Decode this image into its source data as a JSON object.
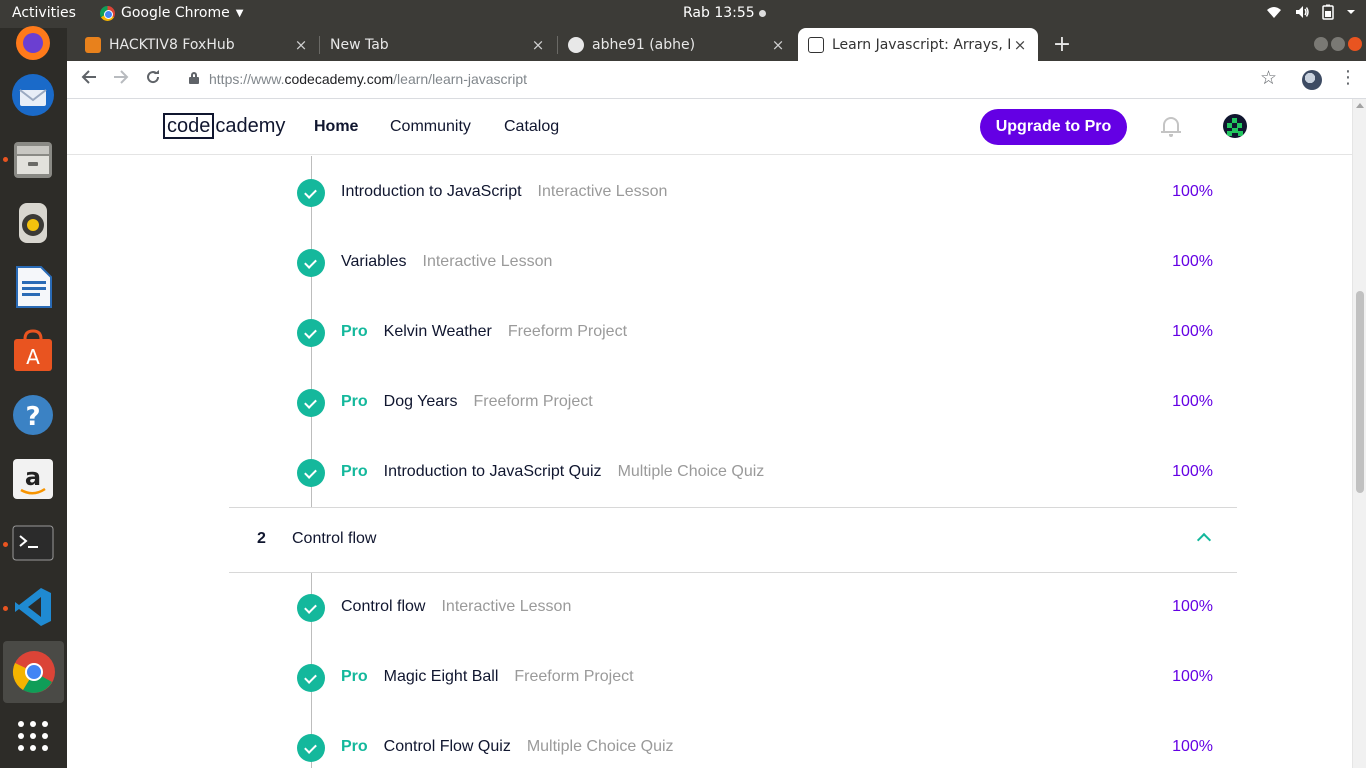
{
  "system": {
    "activities": "Activities",
    "app_name": "Google Chrome",
    "clock": "Rab 13:55"
  },
  "dock": [
    {
      "name": "firefox-icon"
    },
    {
      "name": "thunderbird-icon"
    },
    {
      "name": "files-icon"
    },
    {
      "name": "rhythmbox-icon"
    },
    {
      "name": "writer-icon"
    },
    {
      "name": "software-center-icon"
    },
    {
      "name": "help-icon"
    },
    {
      "name": "amazon-icon"
    },
    {
      "name": "terminal-icon"
    },
    {
      "name": "vscode-icon"
    },
    {
      "name": "chrome-icon"
    },
    {
      "name": "show-apps-icon"
    }
  ],
  "tabs": [
    {
      "title": "HACKTIV8 FoxHub",
      "close": "×"
    },
    {
      "title": "New Tab",
      "close": "×"
    },
    {
      "title": "abhe91 (abhe)",
      "close": "×"
    },
    {
      "title": "Learn Javascript: Arrays, L",
      "close": "×"
    }
  ],
  "toolbar": {
    "url_scheme": "https://www.",
    "url_host": "codecademy.com",
    "url_path": "/learn/learn-javascript"
  },
  "header": {
    "logo_box": "code",
    "logo_rest": "cademy",
    "nav": [
      "Home",
      "Community",
      "Catalog"
    ],
    "upgrade_label": "Upgrade to Pro"
  },
  "colors": {
    "accent_purple": "#6400e4",
    "complete_teal": "#14b89c",
    "navy": "#10162f"
  },
  "section1_lessons": [
    {
      "pro": "",
      "name": "Introduction to JavaScript",
      "type": "Interactive Lesson",
      "progress": "100%"
    },
    {
      "pro": "",
      "name": "Variables",
      "type": "Interactive Lesson",
      "progress": "100%"
    },
    {
      "pro": "Pro",
      "name": "Kelvin Weather",
      "type": "Freeform Project",
      "progress": "100%"
    },
    {
      "pro": "Pro",
      "name": "Dog Years",
      "type": "Freeform Project",
      "progress": "100%"
    },
    {
      "pro": "Pro",
      "name": "Introduction to JavaScript Quiz",
      "type": "Multiple Choice Quiz",
      "progress": "100%"
    }
  ],
  "section2": {
    "number": "2",
    "title": "Control flow",
    "lessons": [
      {
        "pro": "",
        "name": "Control flow",
        "type": "Interactive Lesson",
        "progress": "100%"
      },
      {
        "pro": "Pro",
        "name": "Magic Eight Ball",
        "type": "Freeform Project",
        "progress": "100%"
      },
      {
        "pro": "Pro",
        "name": "Control Flow Quiz",
        "type": "Multiple Choice Quiz",
        "progress": "100%"
      }
    ]
  }
}
